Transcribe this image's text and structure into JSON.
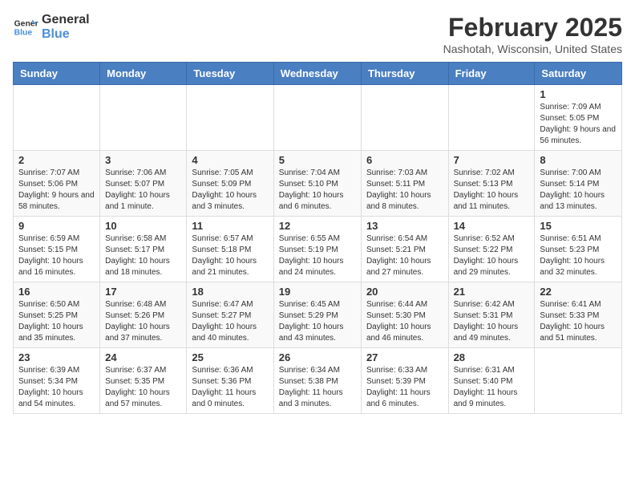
{
  "header": {
    "logo_general": "General",
    "logo_blue": "Blue",
    "month_title": "February 2025",
    "location": "Nashotah, Wisconsin, United States"
  },
  "weekdays": [
    "Sunday",
    "Monday",
    "Tuesday",
    "Wednesday",
    "Thursday",
    "Friday",
    "Saturday"
  ],
  "weeks": [
    [
      {
        "day": "",
        "info": ""
      },
      {
        "day": "",
        "info": ""
      },
      {
        "day": "",
        "info": ""
      },
      {
        "day": "",
        "info": ""
      },
      {
        "day": "",
        "info": ""
      },
      {
        "day": "",
        "info": ""
      },
      {
        "day": "1",
        "info": "Sunrise: 7:09 AM\nSunset: 5:05 PM\nDaylight: 9 hours and 56 minutes."
      }
    ],
    [
      {
        "day": "2",
        "info": "Sunrise: 7:07 AM\nSunset: 5:06 PM\nDaylight: 9 hours and 58 minutes."
      },
      {
        "day": "3",
        "info": "Sunrise: 7:06 AM\nSunset: 5:07 PM\nDaylight: 10 hours and 1 minute."
      },
      {
        "day": "4",
        "info": "Sunrise: 7:05 AM\nSunset: 5:09 PM\nDaylight: 10 hours and 3 minutes."
      },
      {
        "day": "5",
        "info": "Sunrise: 7:04 AM\nSunset: 5:10 PM\nDaylight: 10 hours and 6 minutes."
      },
      {
        "day": "6",
        "info": "Sunrise: 7:03 AM\nSunset: 5:11 PM\nDaylight: 10 hours and 8 minutes."
      },
      {
        "day": "7",
        "info": "Sunrise: 7:02 AM\nSunset: 5:13 PM\nDaylight: 10 hours and 11 minutes."
      },
      {
        "day": "8",
        "info": "Sunrise: 7:00 AM\nSunset: 5:14 PM\nDaylight: 10 hours and 13 minutes."
      }
    ],
    [
      {
        "day": "9",
        "info": "Sunrise: 6:59 AM\nSunset: 5:15 PM\nDaylight: 10 hours and 16 minutes."
      },
      {
        "day": "10",
        "info": "Sunrise: 6:58 AM\nSunset: 5:17 PM\nDaylight: 10 hours and 18 minutes."
      },
      {
        "day": "11",
        "info": "Sunrise: 6:57 AM\nSunset: 5:18 PM\nDaylight: 10 hours and 21 minutes."
      },
      {
        "day": "12",
        "info": "Sunrise: 6:55 AM\nSunset: 5:19 PM\nDaylight: 10 hours and 24 minutes."
      },
      {
        "day": "13",
        "info": "Sunrise: 6:54 AM\nSunset: 5:21 PM\nDaylight: 10 hours and 27 minutes."
      },
      {
        "day": "14",
        "info": "Sunrise: 6:52 AM\nSunset: 5:22 PM\nDaylight: 10 hours and 29 minutes."
      },
      {
        "day": "15",
        "info": "Sunrise: 6:51 AM\nSunset: 5:23 PM\nDaylight: 10 hours and 32 minutes."
      }
    ],
    [
      {
        "day": "16",
        "info": "Sunrise: 6:50 AM\nSunset: 5:25 PM\nDaylight: 10 hours and 35 minutes."
      },
      {
        "day": "17",
        "info": "Sunrise: 6:48 AM\nSunset: 5:26 PM\nDaylight: 10 hours and 37 minutes."
      },
      {
        "day": "18",
        "info": "Sunrise: 6:47 AM\nSunset: 5:27 PM\nDaylight: 10 hours and 40 minutes."
      },
      {
        "day": "19",
        "info": "Sunrise: 6:45 AM\nSunset: 5:29 PM\nDaylight: 10 hours and 43 minutes."
      },
      {
        "day": "20",
        "info": "Sunrise: 6:44 AM\nSunset: 5:30 PM\nDaylight: 10 hours and 46 minutes."
      },
      {
        "day": "21",
        "info": "Sunrise: 6:42 AM\nSunset: 5:31 PM\nDaylight: 10 hours and 49 minutes."
      },
      {
        "day": "22",
        "info": "Sunrise: 6:41 AM\nSunset: 5:33 PM\nDaylight: 10 hours and 51 minutes."
      }
    ],
    [
      {
        "day": "23",
        "info": "Sunrise: 6:39 AM\nSunset: 5:34 PM\nDaylight: 10 hours and 54 minutes."
      },
      {
        "day": "24",
        "info": "Sunrise: 6:37 AM\nSunset: 5:35 PM\nDaylight: 10 hours and 57 minutes."
      },
      {
        "day": "25",
        "info": "Sunrise: 6:36 AM\nSunset: 5:36 PM\nDaylight: 11 hours and 0 minutes."
      },
      {
        "day": "26",
        "info": "Sunrise: 6:34 AM\nSunset: 5:38 PM\nDaylight: 11 hours and 3 minutes."
      },
      {
        "day": "27",
        "info": "Sunrise: 6:33 AM\nSunset: 5:39 PM\nDaylight: 11 hours and 6 minutes."
      },
      {
        "day": "28",
        "info": "Sunrise: 6:31 AM\nSunset: 5:40 PM\nDaylight: 11 hours and 9 minutes."
      },
      {
        "day": "",
        "info": ""
      }
    ]
  ]
}
